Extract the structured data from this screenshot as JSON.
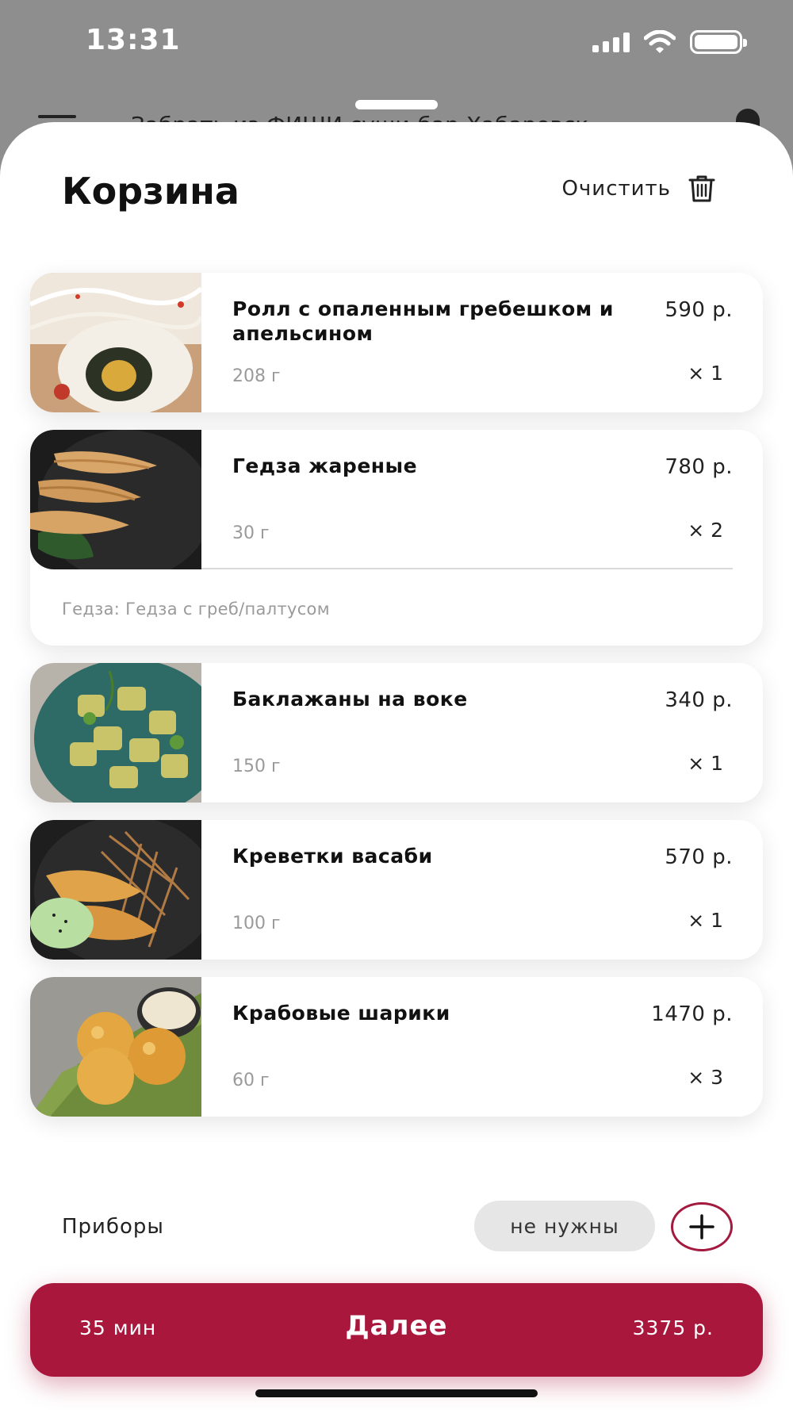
{
  "status_bar": {
    "time": "13:31",
    "icons": [
      "signal-icon",
      "wifi-icon",
      "battery-icon"
    ]
  },
  "under_header": {
    "text": "Забрать из ФИШИ суши-бар Хабаровск"
  },
  "cart": {
    "title": "Корзина",
    "clear_label": "Очистить",
    "items": [
      {
        "name": "Ролл с опаленным гребешком и апельсином",
        "price": "590 р.",
        "weight": "208 г",
        "qty": "× 1",
        "option": ""
      },
      {
        "name": "Гедза жареные",
        "price": "780 р.",
        "weight": "30 г",
        "qty": "× 2",
        "option": "Гедза: Гедза с греб/палтусом"
      },
      {
        "name": "Баклажаны на воке",
        "price": "340 р.",
        "weight": "150 г",
        "qty": "× 1",
        "option": ""
      },
      {
        "name": "Креветки васаби",
        "price": "570 р.",
        "weight": "100 г",
        "qty": "× 1",
        "option": ""
      },
      {
        "name": "Крабовые шарики",
        "price": "1470 р.",
        "weight": "60 г",
        "qty": "× 3",
        "option": ""
      }
    ]
  },
  "cutlery": {
    "label": "Приборы",
    "value": "не нужны"
  },
  "cta": {
    "time": "35 мин",
    "label": "Далее",
    "total": "3375 р."
  },
  "colors": {
    "accent": "#a9173d",
    "pill_bg": "#e6e6e6",
    "overlay": "#8e8e8e"
  }
}
